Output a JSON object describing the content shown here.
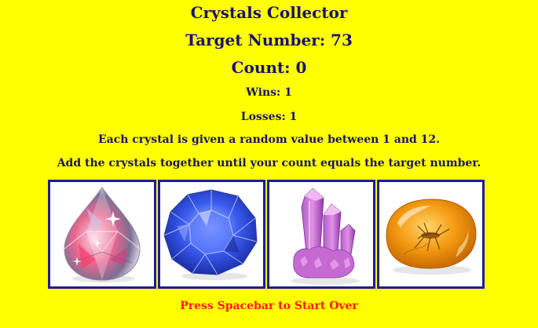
{
  "title": "Crystals Collector",
  "target": "Target Number: 73",
  "count": "Count: 0",
  "wins": "Wins: 1",
  "losses": "Losses: 1",
  "instructions": {
    "line1": "Each crystal is given a random value between 1 and 12.",
    "line2": "Add the crystals together until your count equals the target number."
  },
  "crystals": [
    {
      "icon": "teardrop-crystal-icon"
    },
    {
      "icon": "blue-round-gem-icon"
    },
    {
      "icon": "purple-quartz-cluster-icon"
    },
    {
      "icon": "amber-stone-icon"
    }
  ],
  "restart_prompt": "Press Spacebar to Start Over",
  "colors": {
    "background": "#ffff00",
    "text": "#1a1370",
    "frame": "#1e1a9c",
    "restart": "#ff1a1a"
  }
}
